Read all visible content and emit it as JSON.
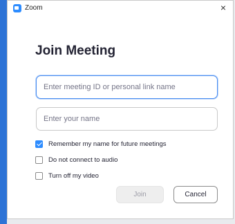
{
  "window": {
    "app_title": "Zoom",
    "close_glyph": "×",
    "app_icon": "zoom-camera-icon"
  },
  "dialog": {
    "heading": "Join Meeting",
    "meeting_id_placeholder": "Enter meeting ID or personal link name",
    "meeting_id_value": "",
    "name_placeholder": "Enter your name",
    "name_value": ""
  },
  "options": [
    {
      "label": "Remember my name for future meetings",
      "checked": true
    },
    {
      "label": "Do not connect to audio",
      "checked": false
    },
    {
      "label": "Turn off my video",
      "checked": false
    }
  ],
  "buttons": {
    "join_label": "Join",
    "join_enabled": false,
    "cancel_label": "Cancel"
  },
  "colors": {
    "accent": "#2d8cff",
    "focus_border": "#4a8df0",
    "desktop_edge": "#2d73d6"
  }
}
